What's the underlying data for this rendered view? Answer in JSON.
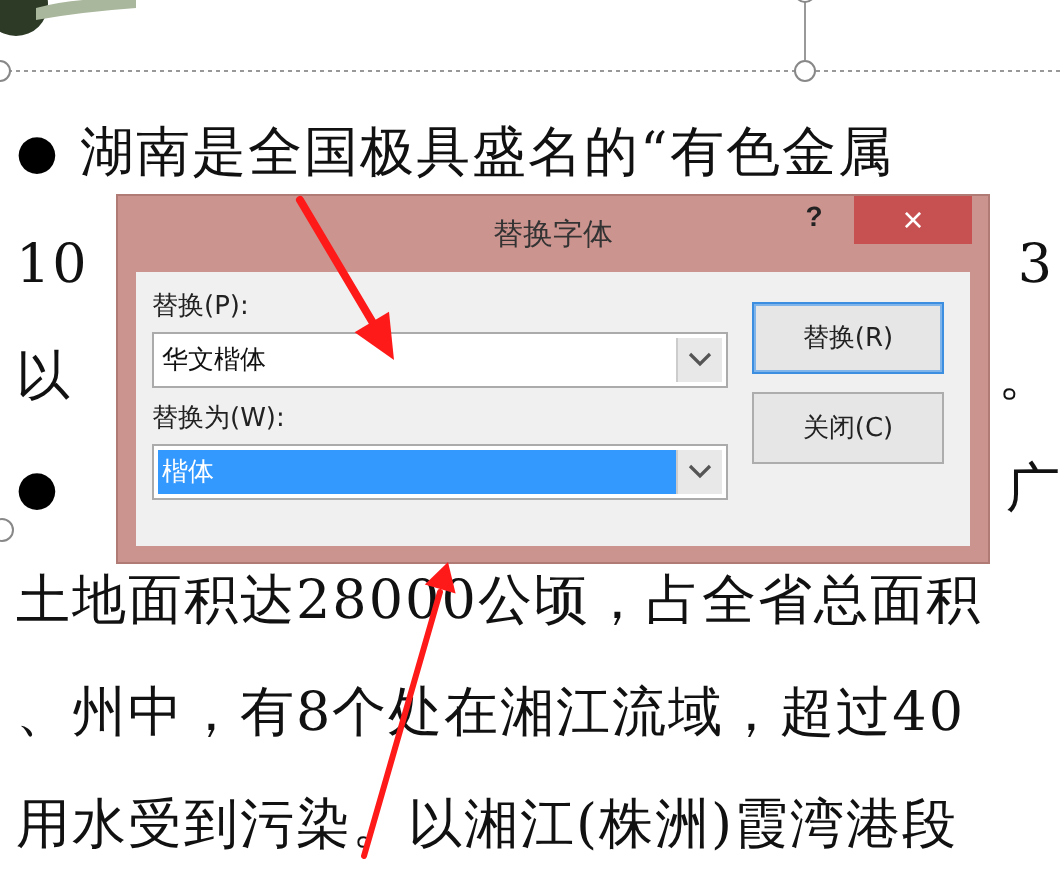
{
  "slide": {
    "lines": [
      {
        "bullet": "●",
        "segments": [
          "湖南是全国极具盛名的“有色金属"
        ]
      },
      {
        "segments": [
          "10",
          "3"
        ]
      },
      {
        "segments": [
          "以",
          "。"
        ]
      },
      {
        "bullet": "●",
        "right": true,
        "segments": [
          "广"
        ]
      },
      {
        "segments": [
          "土地面积达28000公顷，占全省总面积"
        ]
      },
      {
        "segments": [
          "、州中，有8个处在湘江流域，超过40"
        ]
      },
      {
        "segments": [
          "用水受到污染。以湘江(株洲)霞湾港段"
        ]
      }
    ]
  },
  "dialog": {
    "title": "替换字体",
    "help": "?",
    "close": "×",
    "fields": [
      {
        "label": "替换(P):",
        "value": "华文楷体",
        "selected": false
      },
      {
        "label": "替换为(W):",
        "value": "楷体",
        "selected": true
      }
    ],
    "buttons": [
      {
        "label": "替换(R)",
        "default": true
      },
      {
        "label": "关闭(C)",
        "default": false
      }
    ]
  }
}
